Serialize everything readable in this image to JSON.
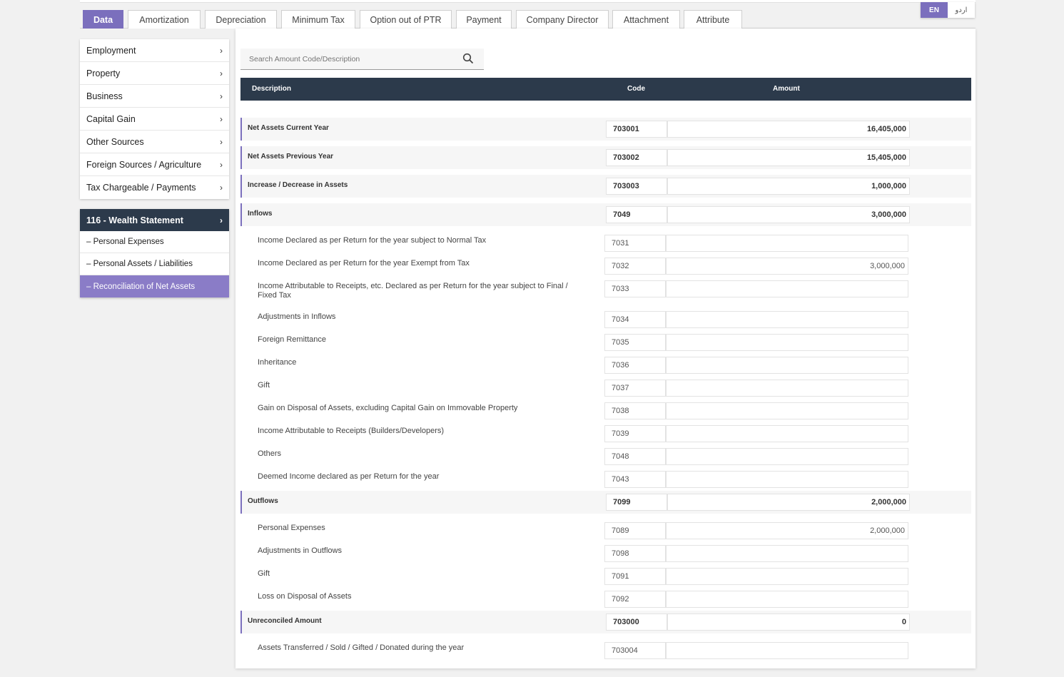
{
  "tabs": [
    "Data",
    "Amortization",
    "Depreciation",
    "Minimum Tax",
    "Option out of PTR",
    "Payment",
    "Company Director",
    "Attachment",
    "Attribute"
  ],
  "lang": {
    "en": "EN",
    "ur": "اردو"
  },
  "sidebar": {
    "items": [
      "Employment",
      "Property",
      "Business",
      "Capital Gain",
      "Other Sources",
      "Foreign Sources / Agriculture",
      "Tax Chargeable / Payments"
    ],
    "section_title": "116 - Wealth Statement",
    "sub_items": [
      "– Personal Expenses",
      "– Personal Assets / Liabilities",
      "– Reconciliation of Net Assets"
    ]
  },
  "search": {
    "placeholder": "Search Amount Code/Description"
  },
  "table": {
    "headers": {
      "description": "Description",
      "code": "Code",
      "amount": "Amount"
    },
    "rows": [
      {
        "desc": "Net Assets Current Year",
        "code": "703001",
        "amount": "16,405,000",
        "bold": true
      },
      {
        "desc": "Net Assets Previous Year",
        "code": "703002",
        "amount": "15,405,000",
        "bold": true
      },
      {
        "desc": "Increase / Decrease in Assets",
        "code": "703003",
        "amount": "1,000,000",
        "bold": true
      },
      {
        "desc": "Inflows",
        "code": "7049",
        "amount": "3,000,000",
        "bold": true
      },
      {
        "desc": "Income Declared as per Return for the year subject to Normal Tax",
        "code": "7031",
        "amount": ""
      },
      {
        "desc": "Income Declared as per Return for the year Exempt from Tax",
        "code": "7032",
        "amount": "3,000,000"
      },
      {
        "desc": "Income Attributable to Receipts, etc. Declared as per Return for the year subject to Final / Fixed Tax",
        "code": "7033",
        "amount": ""
      },
      {
        "desc": "Adjustments in Inflows",
        "code": "7034",
        "amount": ""
      },
      {
        "desc": "Foreign Remittance",
        "code": "7035",
        "amount": ""
      },
      {
        "desc": "Inheritance",
        "code": "7036",
        "amount": ""
      },
      {
        "desc": "Gift",
        "code": "7037",
        "amount": ""
      },
      {
        "desc": "Gain on Disposal of Assets, excluding Capital Gain on Immovable Property",
        "code": "7038",
        "amount": ""
      },
      {
        "desc": "Income Attributable to Receipts (Builders/Developers)",
        "code": "7039",
        "amount": ""
      },
      {
        "desc": "Others",
        "code": "7048",
        "amount": ""
      },
      {
        "desc": "Deemed Income declared as per Return for the year",
        "code": "7043",
        "amount": ""
      },
      {
        "desc": "Outflows",
        "code": "7099",
        "amount": "2,000,000",
        "bold": true
      },
      {
        "desc": "Personal Expenses",
        "code": "7089",
        "amount": "2,000,000"
      },
      {
        "desc": "Adjustments in Outflows",
        "code": "7098",
        "amount": ""
      },
      {
        "desc": "Gift",
        "code": "7091",
        "amount": ""
      },
      {
        "desc": "Loss on Disposal of Assets",
        "code": "7092",
        "amount": ""
      },
      {
        "desc": "Unreconciled Amount",
        "code": "703000",
        "amount": "0",
        "bold": true
      },
      {
        "desc": "Assets Transferred / Sold / Gifted / Donated during the year",
        "code": "703004",
        "amount": ""
      }
    ]
  },
  "colors": {
    "accent": "#7b6fbd",
    "header_bg": "#2c3a4b"
  }
}
